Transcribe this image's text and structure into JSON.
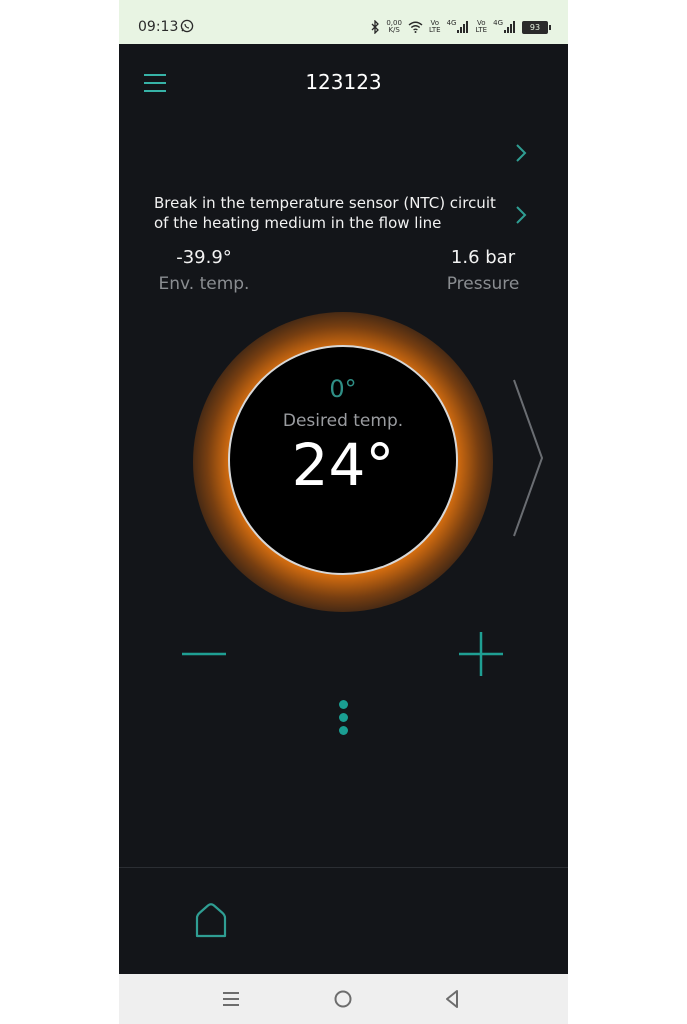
{
  "status_bar": {
    "time": "09:13",
    "net_speed_value": "0,00",
    "net_speed_unit": "K/S",
    "sim1_top": "Vo",
    "sim1_bottom": "LTE",
    "sim1_gen": "4G",
    "sim2_top": "Vo",
    "sim2_bottom": "LTE",
    "sim2_gen": "4G",
    "battery": "93"
  },
  "header": {
    "title": "123123",
    "menu_icon": "hamburger-icon"
  },
  "alert": {
    "message": "Break in the temperature sensor (NTC) circuit of the heating medium in the flow line"
  },
  "stats": {
    "env_temp_value": "-39.9°",
    "env_temp_label": "Env. temp.",
    "pressure_value": "1.6 bar",
    "pressure_label": "Pressure"
  },
  "dial": {
    "current_temp": "0°",
    "label": "Desired temp.",
    "setpoint": "24°"
  },
  "colors": {
    "accent": "#37b3a7",
    "background": "#131519",
    "glow": "#e2740f"
  },
  "bottom_nav": {
    "home_icon": "home-icon"
  },
  "android_nav": {
    "recents_icon": "recents-icon",
    "home_icon": "circle-home-icon",
    "back_icon": "back-triangle-icon"
  }
}
